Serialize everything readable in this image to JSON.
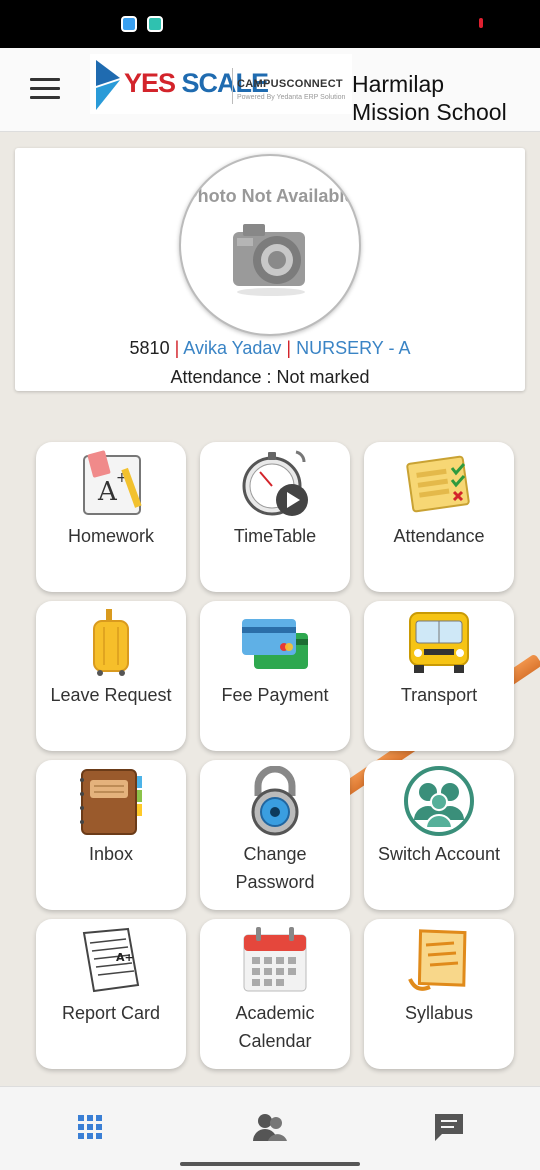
{
  "header": {
    "logo_brand_a": "YES",
    "logo_brand_b": "SCALE",
    "logo_product": "CAMPUSCONNECT",
    "logo_powered": "Powered By Yedanta ERP Solution",
    "school_name_line1": "Harmilap",
    "school_name_line2": "Mission School"
  },
  "profile": {
    "photo_placeholder": "Photo Not Available",
    "student_id": "5810",
    "separator": "|",
    "student_name": "Avika Yadav",
    "class_section": "NURSERY - A",
    "attendance": "Attendance : Not marked"
  },
  "tiles": [
    {
      "label": "Homework",
      "icon": "homework-icon"
    },
    {
      "label": "TimeTable",
      "icon": "stopwatch-icon"
    },
    {
      "label": "Attendance",
      "icon": "checklist-icon"
    },
    {
      "label": "Leave Request",
      "icon": "suitcase-icon"
    },
    {
      "label": "Fee Payment",
      "icon": "credit-card-icon"
    },
    {
      "label": "Transport",
      "icon": "bus-icon"
    },
    {
      "label": "Inbox",
      "icon": "notebook-icon"
    },
    {
      "label_line1": "Change",
      "label_line2": "Password",
      "icon": "padlock-icon"
    },
    {
      "label": "Switch Account",
      "icon": "users-icon"
    },
    {
      "label": "Report Card",
      "icon": "report-paper-icon"
    },
    {
      "label_line1": "Academic",
      "label_line2": "Calendar",
      "icon": "calendar-icon"
    },
    {
      "label": "Syllabus",
      "icon": "syllabus-icon"
    }
  ],
  "bottom_nav": [
    {
      "icon": "grid-icon"
    },
    {
      "icon": "people-icon"
    },
    {
      "icon": "chat-icon"
    }
  ],
  "colors": {
    "accent_blue": "#3a84c5",
    "brand_red": "#d3242b",
    "nav_active": "#3a7fd5"
  }
}
